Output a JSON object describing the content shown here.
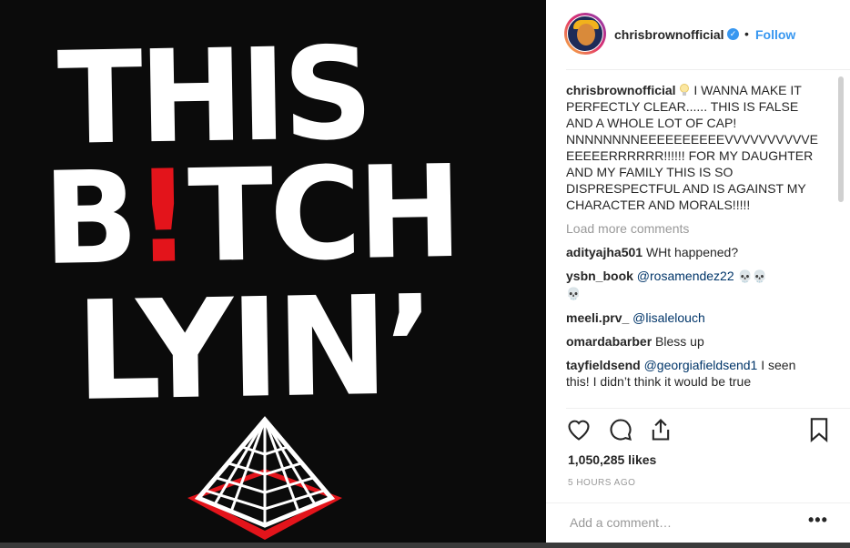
{
  "image": {
    "line1": "THIS",
    "line2_pre": "B",
    "line2_red": "!",
    "line2_post": "TCH",
    "line3": "LYIN’",
    "accent_red": "#e3141b"
  },
  "header": {
    "username": "chrisbrownofficial",
    "verified_icon": "check",
    "separator": "•",
    "follow_label": "Follow"
  },
  "caption": {
    "username": "chrisbrownofficial",
    "text": "I WANNA MAKE IT PERFECTLY CLEAR...... THIS IS FALSE AND A WHOLE LOT OF CAP! NNNNNNNNEEEEEEEEEEVVVVVVVVVVE EEEEERRRRRR!!!!!! FOR MY DAUGHTER AND MY FAMILY THIS IS SO DISPRESPECTFUL AND IS AGAINST MY CHARACTER AND MORALS!!!!!"
  },
  "load_more": "Load more comments",
  "comments": [
    {
      "user": "adityajha501",
      "mention": "",
      "text": "WHt happened?"
    },
    {
      "user": "ysbn_book",
      "mention": "@rosamendez22",
      "text": ""
    },
    {
      "user": "meeli.prv_",
      "mention": "@lisalelouch",
      "text": ""
    },
    {
      "user": "omardabarber",
      "mention": "",
      "text": "Bless up"
    },
    {
      "user": "tayfieldsend",
      "mention": "@georgiafieldsend1",
      "text": "I seen this! I didn’t think it would be true"
    }
  ],
  "likes": "1,050,285 likes",
  "timestamp": "5 HOURS AGO",
  "add_comment_placeholder": "Add a comment…",
  "more_label": "•••",
  "colors": {
    "link": "#3897f0",
    "mention": "#003569",
    "muted": "#999999",
    "text": "#262626"
  }
}
